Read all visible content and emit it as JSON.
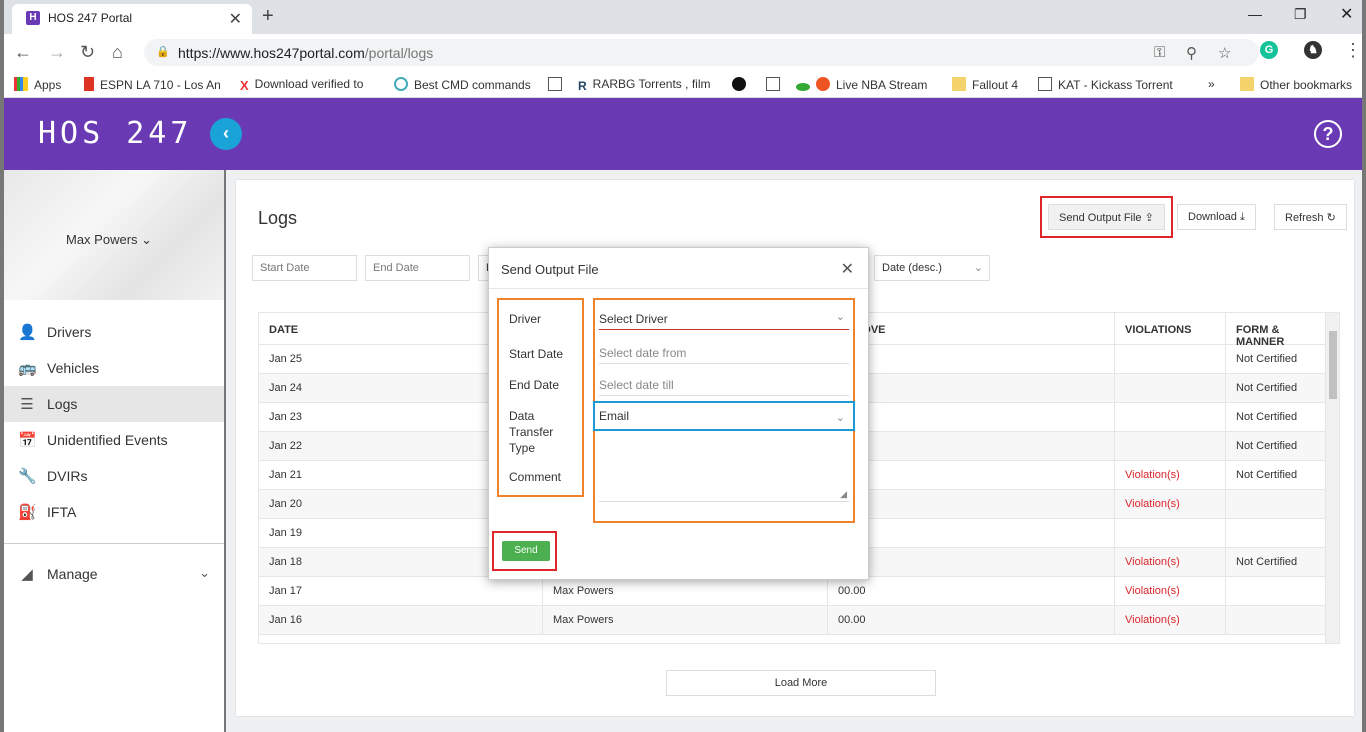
{
  "browser": {
    "tab_title": "HOS 247 Portal",
    "tab_favicon": "H",
    "url_host": "https://www.hos247portal.com",
    "url_path": "/portal/logs",
    "bookmarks": [
      {
        "label": "Apps",
        "icon": "apps-grid-icon"
      },
      {
        "label": "ESPN LA 710 - Los An",
        "icon": "espn-icon"
      },
      {
        "label": "Download verified to",
        "icon": "x-icon"
      },
      {
        "label": "Best CMD commands",
        "icon": "cmd-icon"
      },
      {
        "label": "",
        "icon": "page-icon"
      },
      {
        "label": "RARBG Torrents , film",
        "icon": "rarbg-icon"
      },
      {
        "label": "",
        "icon": "spotify-icon"
      },
      {
        "label": "",
        "icon": "page-icon"
      },
      {
        "label": "Live NBA Stream",
        "icon": "basketball-icon"
      },
      {
        "label": "Fallout 4",
        "icon": "folder-icon"
      },
      {
        "label": "KAT - Kickass Torrent",
        "icon": "page-icon"
      },
      {
        "label": "»",
        "icon": ""
      },
      {
        "label": "Other bookmarks",
        "icon": "folder-icon"
      }
    ]
  },
  "app": {
    "logo": "HOS 247",
    "user_name": "Max Powers",
    "nav": [
      {
        "label": "Drivers",
        "icon": "person-icon",
        "glyph": "👤"
      },
      {
        "label": "Vehicles",
        "icon": "bus-icon",
        "glyph": "🚌"
      },
      {
        "label": "Logs",
        "icon": "list-icon",
        "glyph": "☰"
      },
      {
        "label": "Unidentified Events",
        "icon": "calendar-icon",
        "glyph": "📅"
      },
      {
        "label": "DVIRs",
        "icon": "wrench-icon",
        "glyph": "🔧"
      },
      {
        "label": "IFTA",
        "icon": "fuel-icon",
        "glyph": "⛽"
      }
    ],
    "manage_label": "Manage"
  },
  "logs": {
    "title": "Logs",
    "send_output_label": "Send Output File",
    "download_label": "Download",
    "refresh_label": "Refresh",
    "filters": {
      "start_date": "Start Date",
      "end_date": "End Date",
      "third": "D",
      "sort": "Date (desc.)"
    },
    "columns": {
      "date": "DATE",
      "drove": "S DROVE",
      "violations": "VIOLATIONS",
      "form": "FORM & MANNER"
    },
    "rows": [
      {
        "date": "Jan 25",
        "driver": "",
        "drove": "",
        "violation": "",
        "form": "Not Certified"
      },
      {
        "date": "Jan 24",
        "driver": "",
        "drove": "",
        "violation": "",
        "form": "Not Certified"
      },
      {
        "date": "Jan 23",
        "driver": "",
        "drove": "",
        "violation": "",
        "form": "Not Certified"
      },
      {
        "date": "Jan 22",
        "driver": "",
        "drove": "",
        "violation": "",
        "form": "Not Certified"
      },
      {
        "date": "Jan 21",
        "driver": "",
        "drove": "",
        "violation": "Violation(s)",
        "form": "Not Certified"
      },
      {
        "date": "Jan 20",
        "driver": "",
        "drove": "",
        "violation": "Violation(s)",
        "form": ""
      },
      {
        "date": "Jan 19",
        "driver": "",
        "drove": "",
        "violation": "",
        "form": ""
      },
      {
        "date": "Jan 18",
        "driver": "",
        "drove": "",
        "violation": "Violation(s)",
        "form": "Not Certified"
      },
      {
        "date": "Jan 17",
        "driver": "Max Powers",
        "drove": "00.00",
        "violation": "Violation(s)",
        "form": ""
      },
      {
        "date": "Jan 16",
        "driver": "Max Powers",
        "drove": "00.00",
        "violation": "Violation(s)",
        "form": ""
      }
    ],
    "load_more": "Load More"
  },
  "modal": {
    "title": "Send Output File",
    "labels": {
      "driver": "Driver",
      "start_date": "Start Date",
      "end_date": "End Date",
      "transfer_type": "Data Transfer Type",
      "comment": "Comment"
    },
    "driver_placeholder": "Select Driver",
    "start_placeholder": "Select date from",
    "end_placeholder": "Select date till",
    "transfer_value": "Email",
    "send_label": "Send"
  },
  "colors": {
    "brand_purple": "#6a3ab5",
    "accent_blue": "#1aa3d6",
    "highlight_red": "#e0262b",
    "highlight_orange": "#f0822a",
    "highlight_blue": "#1b9ad6",
    "send_green": "#4caf50",
    "violation_red": "#d9262b"
  }
}
